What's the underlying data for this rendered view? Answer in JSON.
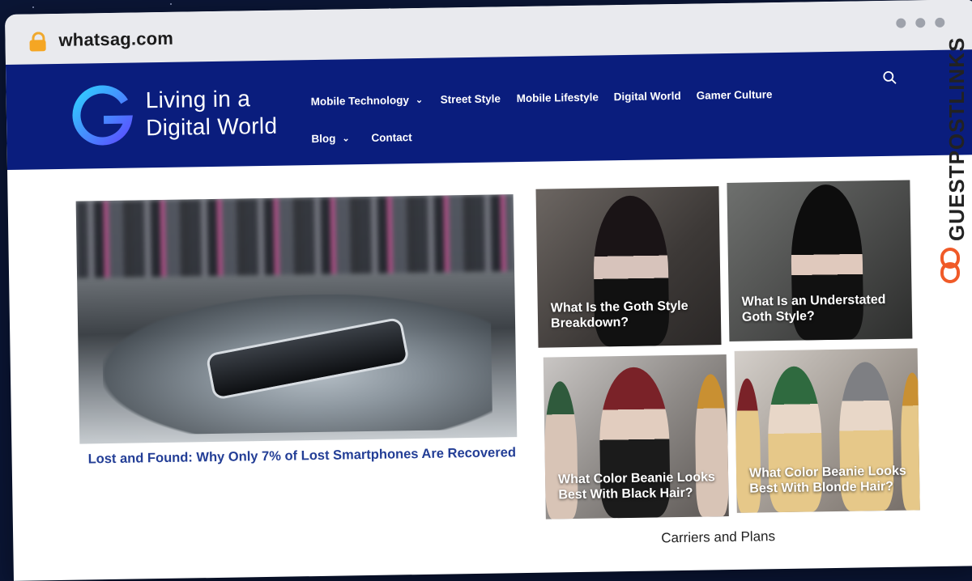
{
  "browser": {
    "url": "whatsag.com"
  },
  "site": {
    "brand_line1": "Living in a",
    "brand_line2": "Digital World",
    "brand_color": "#0a1d7d"
  },
  "nav": {
    "items": [
      {
        "label": "Mobile Technology",
        "has_dropdown": true
      },
      {
        "label": "Street Style",
        "has_dropdown": false
      },
      {
        "label": "Mobile Lifestyle",
        "has_dropdown": false
      },
      {
        "label": "Digital World",
        "has_dropdown": false
      },
      {
        "label": "Gamer Culture",
        "has_dropdown": false
      },
      {
        "label": "Blog",
        "has_dropdown": true
      },
      {
        "label": "Contact",
        "has_dropdown": false
      }
    ],
    "chevron": "⌄",
    "search_icon": "search-icon"
  },
  "hero": {
    "title": "Lost and Found: Why Only 7% of Lost Smartphones Are Recovered"
  },
  "cards": [
    {
      "title": "What Is the Goth Style Breakdown?"
    },
    {
      "title": "What Is an Understated Goth Style?"
    },
    {
      "title": "What Color Beanie Looks Best With Black Hair?"
    },
    {
      "title": "What Color Beanie Looks Best With Blonde Hair?"
    }
  ],
  "sections": {
    "left_heading": "",
    "right_heading": "Carriers and Plans"
  },
  "watermark": {
    "text": "GUESTPOSTLINKS",
    "accent_color": "#f05a28"
  }
}
